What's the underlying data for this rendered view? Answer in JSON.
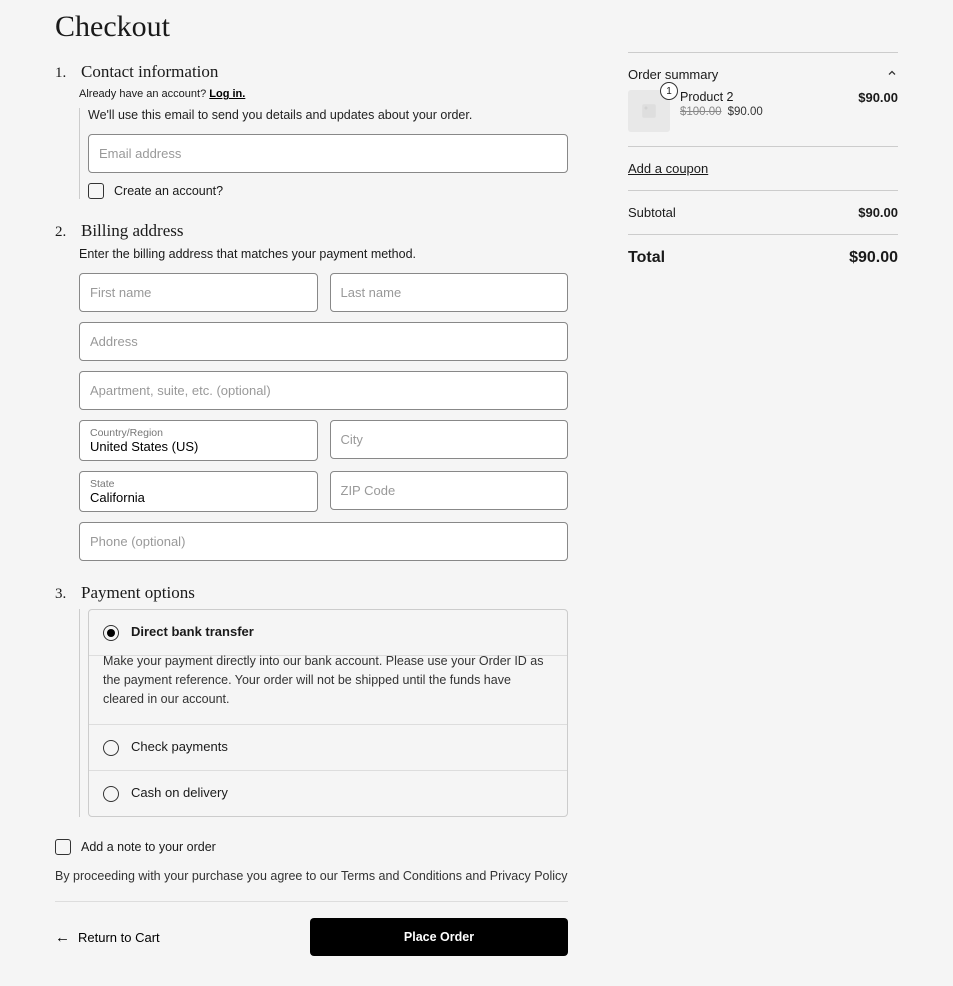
{
  "page_title": "Checkout",
  "contact": {
    "step_number": "1.",
    "title": "Contact information",
    "already_text": "Already have an account? ",
    "login_link": "Log in.",
    "help": "We'll use this email to send you details and updates about your order.",
    "email_placeholder": "Email address",
    "create_account_label": "Create an account?"
  },
  "billing": {
    "step_number": "2.",
    "title": "Billing address",
    "help": "Enter the billing address that matches your payment method.",
    "first_name_placeholder": "First name",
    "last_name_placeholder": "Last name",
    "address_placeholder": "Address",
    "apt_placeholder": "Apartment, suite, etc. (optional)",
    "country_label": "Country/Region",
    "country_value": "United States (US)",
    "city_placeholder": "City",
    "state_label": "State",
    "state_value": "California",
    "zip_placeholder": "ZIP Code",
    "phone_placeholder": "Phone (optional)"
  },
  "payment": {
    "step_number": "3.",
    "title": "Payment options",
    "options": [
      {
        "label": "Direct bank transfer",
        "selected": true,
        "desc": "Make your payment directly into our bank account. Please use your Order ID as the payment reference. Your order will not be shipped until the funds have cleared in our account."
      },
      {
        "label": "Check payments",
        "selected": false
      },
      {
        "label": "Cash on delivery",
        "selected": false
      }
    ]
  },
  "note_label": "Add a note to your order",
  "terms_text": "By proceeding with your purchase you agree to our Terms and Conditions and Privacy Policy",
  "return_label": "Return to Cart",
  "place_order_label": "Place Order",
  "order_summary": {
    "title": "Order summary",
    "item": {
      "qty": "1",
      "name": "Product 2",
      "orig": "$100.00",
      "sale": "$90.00",
      "line_total": "$90.00"
    },
    "coupon_link": "Add a coupon",
    "subtotal_label": "Subtotal",
    "subtotal_value": "$90.00",
    "total_label": "Total",
    "total_value": "$90.00"
  }
}
